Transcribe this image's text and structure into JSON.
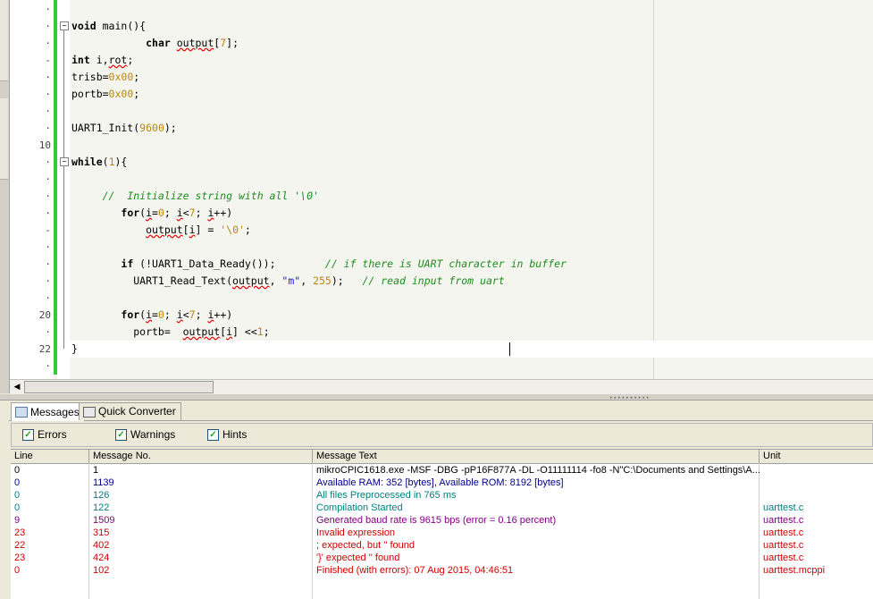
{
  "editor": {
    "lines": [
      {
        "ln": "·",
        "html": ""
      },
      {
        "ln": "·",
        "html": "<span class='kw'>void</span> main(){"
      },
      {
        "ln": "·",
        "html": "            <span class='kw'>char</span> <span class='sq'>output</span>[<span class='num'>7</span>];"
      },
      {
        "ln": "-",
        "html": "<span class='kw'>int</span> i,<span class='sq'>rot</span>;"
      },
      {
        "ln": "·",
        "html": "trisb=<span class='num'>0x00</span>;"
      },
      {
        "ln": "·",
        "html": "portb=<span class='num'>0x00</span>;"
      },
      {
        "ln": "·",
        "html": ""
      },
      {
        "ln": "·",
        "html": "UART1_Init(<span class='num'>9600</span>);"
      },
      {
        "ln": "10",
        "html": ""
      },
      {
        "ln": "·",
        "html": "<span class='kw'>while</span>(<span class='num'>1</span>){"
      },
      {
        "ln": "·",
        "html": ""
      },
      {
        "ln": "·",
        "html": "     <span class='cmt'>//  Initialize string with all '\\0'</span>"
      },
      {
        "ln": "·",
        "html": "        <span class='kw'>for</span>(<span class='sq'>i</span>=<span class='num'>0</span>; <span class='sq'>i</span>&lt;<span class='num'>7</span>; <span class='sq'>i</span>++)"
      },
      {
        "ln": "-",
        "html": "            <span class='sq'>output</span>[<span class='sq'>i</span>] = <span class='num'>'\\0'</span>;"
      },
      {
        "ln": "·",
        "html": ""
      },
      {
        "ln": "·",
        "html": "        <span class='kw'>if</span> (!UART1_Data_Ready());        <span class='cmt'>// if there is UART character in buffer</span>"
      },
      {
        "ln": "·",
        "html": "          UART1_Read_Text(<span class='sq'>output</span>, <span class='str'>\"m\"</span>, <span class='num'>255</span>);   <span class='cmt'>// read input from uart</span>"
      },
      {
        "ln": "·",
        "html": ""
      },
      {
        "ln": "20",
        "html": "        <span class='kw'>for</span>(<span class='sq'>i</span>=<span class='num'>0</span>; <span class='sq'>i</span>&lt;<span class='num'>7</span>; <span class='sq'>i</span>++)"
      },
      {
        "ln": "·",
        "html": "          portb=  <span class='sq'>output</span>[<span class='sq'>i</span>] &lt;&lt;<span class='num'>1</span>;"
      },
      {
        "ln": "22",
        "html": "}"
      },
      {
        "ln": "·",
        "html": ""
      }
    ]
  },
  "tabs": {
    "messages": "Messages",
    "quick_converter": "Quick Converter"
  },
  "filters": {
    "errors": "Errors",
    "warnings": "Warnings",
    "hints": "Hints"
  },
  "grid": {
    "headers": [
      "Line",
      "Message No.",
      "Message Text",
      "Unit"
    ],
    "rows": [
      {
        "line": "0",
        "no": "1",
        "text": "mikroCPIC1618.exe -MSF -DBG -pP16F877A -DL -O11111114 -fo8 -N\"C:\\Documents and Settings\\A...",
        "unit": "",
        "color": "#000000"
      },
      {
        "line": "0",
        "no": "1139",
        "text": "Available RAM: 352 [bytes], Available ROM: 8192 [bytes]",
        "unit": "",
        "color": "#00008b"
      },
      {
        "line": "0",
        "no": "126",
        "text": "All files Preprocessed in 765 ms",
        "unit": "",
        "color": "#008080"
      },
      {
        "line": "0",
        "no": "122",
        "text": "Compilation Started",
        "unit": "uarttest.c",
        "color": "#008080"
      },
      {
        "line": "9",
        "no": "1509",
        "text": "Generated baud rate is 9615 bps (error = 0.16 percent)",
        "unit": "uarttest.c",
        "color": "#800080"
      },
      {
        "line": "23",
        "no": "315",
        "text": "Invalid expression",
        "unit": "uarttest.c",
        "color": "#d00000"
      },
      {
        "line": "22",
        "no": "402",
        "text": "; expected, but '' found",
        "unit": "uarttest.c",
        "color": "#d00000"
      },
      {
        "line": "23",
        "no": "424",
        "text": "'}' expected '' found",
        "unit": "uarttest.c",
        "color": "#d00000"
      },
      {
        "line": "0",
        "no": "102",
        "text": "Finished (with errors): 07 Aug 2015, 04:46:51",
        "unit": "uarttest.mcppi",
        "color": "#d00000"
      }
    ]
  }
}
